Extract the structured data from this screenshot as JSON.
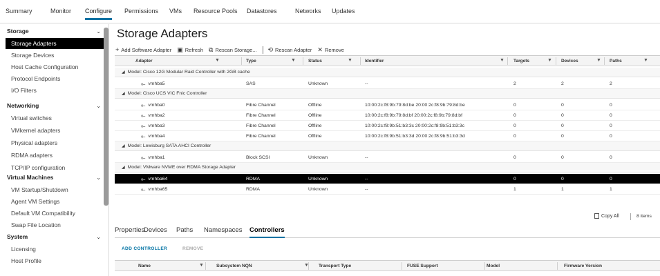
{
  "top_tabs": [
    "Summary",
    "Monitor",
    "Configure",
    "Permissions",
    "VMs",
    "Resource Pools",
    "Datastores",
    "Networks",
    "Updates"
  ],
  "active_top_tab": "Configure",
  "sidebar": {
    "sections": [
      {
        "label": "Storage",
        "items": [
          "Storage Adapters",
          "Storage Devices",
          "Host Cache Configuration",
          "Protocol Endpoints",
          "I/O Filters"
        ]
      },
      {
        "label": "Networking",
        "items": [
          "Virtual switches",
          "VMkernel adapters",
          "Physical adapters",
          "RDMA adapters",
          "TCP/IP configuration"
        ]
      },
      {
        "label": "Virtual Machines",
        "items": [
          "VM Startup/Shutdown",
          "Agent VM Settings",
          "Default VM Compatibility",
          "Swap File Location"
        ]
      },
      {
        "label": "System",
        "items": [
          "Licensing",
          "Host Profile"
        ]
      }
    ],
    "selected_item": "Storage Adapters",
    "chevron": "⌄"
  },
  "page_title": "Storage Adapters",
  "toolbar": [
    {
      "icon": "plus-icon",
      "glyph": "+",
      "label": "Add Software Adapter"
    },
    {
      "icon": "refresh-icon",
      "glyph": "▣",
      "label": "Refresh"
    },
    {
      "icon": "rescan-storage-icon",
      "glyph": "⧉",
      "label": "Rescan Storage..."
    },
    {
      "icon": "rescan-adapter-icon",
      "glyph": "⟲",
      "label": "Rescan Adapter"
    },
    {
      "icon": "remove-icon",
      "glyph": "✕",
      "label": "Remove"
    }
  ],
  "table": {
    "columns": [
      "Adapter",
      "Type",
      "Status",
      "Identifier",
      "Targets",
      "Devices",
      "Paths"
    ],
    "filter_glyph": "▼",
    "adapter_glyph": "⟜",
    "group_caret": "◢",
    "groups": [
      {
        "model": "Model: Cisco 12G Modular Raid Controller with 2GB cache",
        "rows": [
          [
            "vmhba5",
            "SAS",
            "Unknown",
            "--",
            "2",
            "2",
            "2"
          ]
        ]
      },
      {
        "model": "Model: Cisco UCS VIC Fnic Controller",
        "rows": [
          [
            "vmhba0",
            "Fibre Channel",
            "Offline",
            "10:00:2c:f8:9b:79:8d:be 20:00:2c:f8:9b:79:8d:be",
            "0",
            "0",
            "0"
          ],
          [
            "vmhba2",
            "Fibre Channel",
            "Offline",
            "10:00:2c:f8:9b:79:8d:bf 20:00:2c:f8:9b:79:8d:bf",
            "0",
            "0",
            "0"
          ],
          [
            "vmhba3",
            "Fibre Channel",
            "Offline",
            "10:00:2c:f8:9b:51:b3:3c 20:00:2c:f8:9b:51:b3:3c",
            "0",
            "0",
            "0"
          ],
          [
            "vmhba4",
            "Fibre Channel",
            "Offline",
            "10:00:2c:f8:9b:51:b3:3d 20:00:2c:f8:9b:51:b3:3d",
            "0",
            "0",
            "0"
          ]
        ]
      },
      {
        "model": "Model: Lewisburg SATA AHCI Controller",
        "rows": [
          [
            "vmhba1",
            "Block SCSI",
            "Unknown",
            "--",
            "0",
            "0",
            "0"
          ]
        ]
      },
      {
        "model": "Model: VMware NVME over RDMA Storage Adapter",
        "rows": [
          [
            "vmhba64",
            "RDMA",
            "Unknown",
            "--",
            "0",
            "0",
            "0"
          ],
          [
            "vmhba65",
            "RDMA",
            "Unknown",
            "--",
            "1",
            "1",
            "1"
          ]
        ]
      }
    ],
    "selected_adapter": "vmhba64"
  },
  "footer": {
    "copy_all": "Copy All",
    "item_count": "8 items"
  },
  "sub_tabs": [
    "Properties",
    "Devices",
    "Paths",
    "Namespaces",
    "Controllers"
  ],
  "active_sub_tab": "Controllers",
  "sub_actions": {
    "add": "ADD CONTROLLER",
    "remove": "REMOVE"
  },
  "controllers_columns": [
    "Name",
    "Subsystem NQN",
    "Transport Type",
    "FUSE Support",
    "Model",
    "Firmware Version"
  ],
  "colors": {
    "accent": "#0072a3",
    "selected_bg": "#000000"
  }
}
